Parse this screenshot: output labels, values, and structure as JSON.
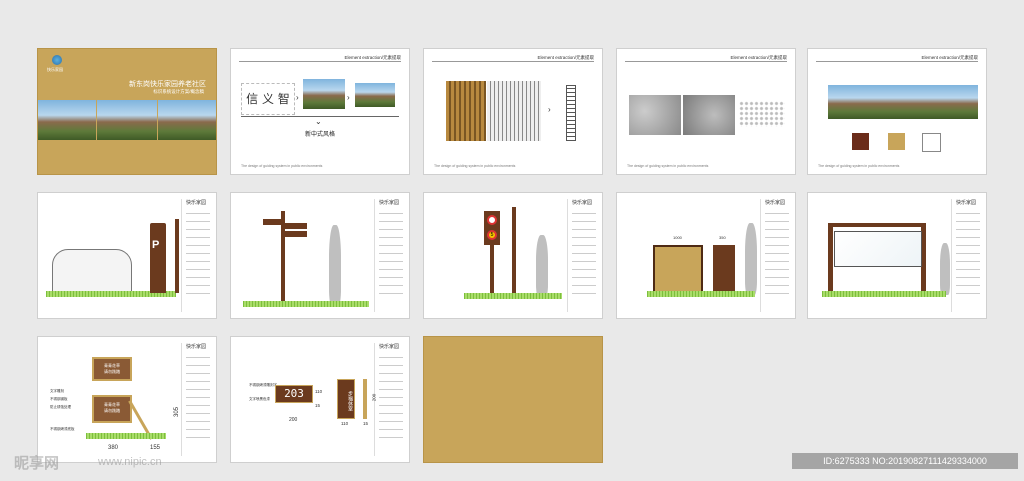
{
  "cover": {
    "title": "新东岗快乐家园养老社区",
    "subtitle": "标识系统设计方案/概念稿",
    "accent": "#c8a55a"
  },
  "element_extraction_label": "Element extraction/元素提取",
  "footer_text": "The design of guiding system in public environments",
  "style_caption": "新中式风格",
  "calligraphy_chars": "信 义 智",
  "brand_mark": "快乐家园",
  "colors": [
    "#6b2c1a",
    "#c8a55a",
    "#ffffff"
  ],
  "sign_number": "203",
  "sign_vertical_text": "步福休室",
  "panel_text": [
    "青青花草",
    "请勿践踏"
  ],
  "dims": {
    "p11_width": "380",
    "p11_width2": "155",
    "p11_height": "305",
    "p12_w1": "200",
    "p12_h1": "110",
    "p12_t1": "15",
    "p12_w2": "110",
    "p12_t2": "15",
    "p12_h2": "200",
    "p9_w1": "1000",
    "p9_w2": "350"
  },
  "callouts": {
    "text_engrave": "文字雕刻",
    "steel_base": "不锈钢钢板",
    "paint": "防止锈蚀处理",
    "steel_frame": "不锈钢烤漆底板",
    "steel_engrave": "不锈钢烤漆雕刻字",
    "text_color": "文字喷黑色漆"
  },
  "watermark": {
    "logo": "昵享网",
    "url": "www.nipic.cn",
    "id": "ID:6275333 NO:20190827111429334000"
  }
}
